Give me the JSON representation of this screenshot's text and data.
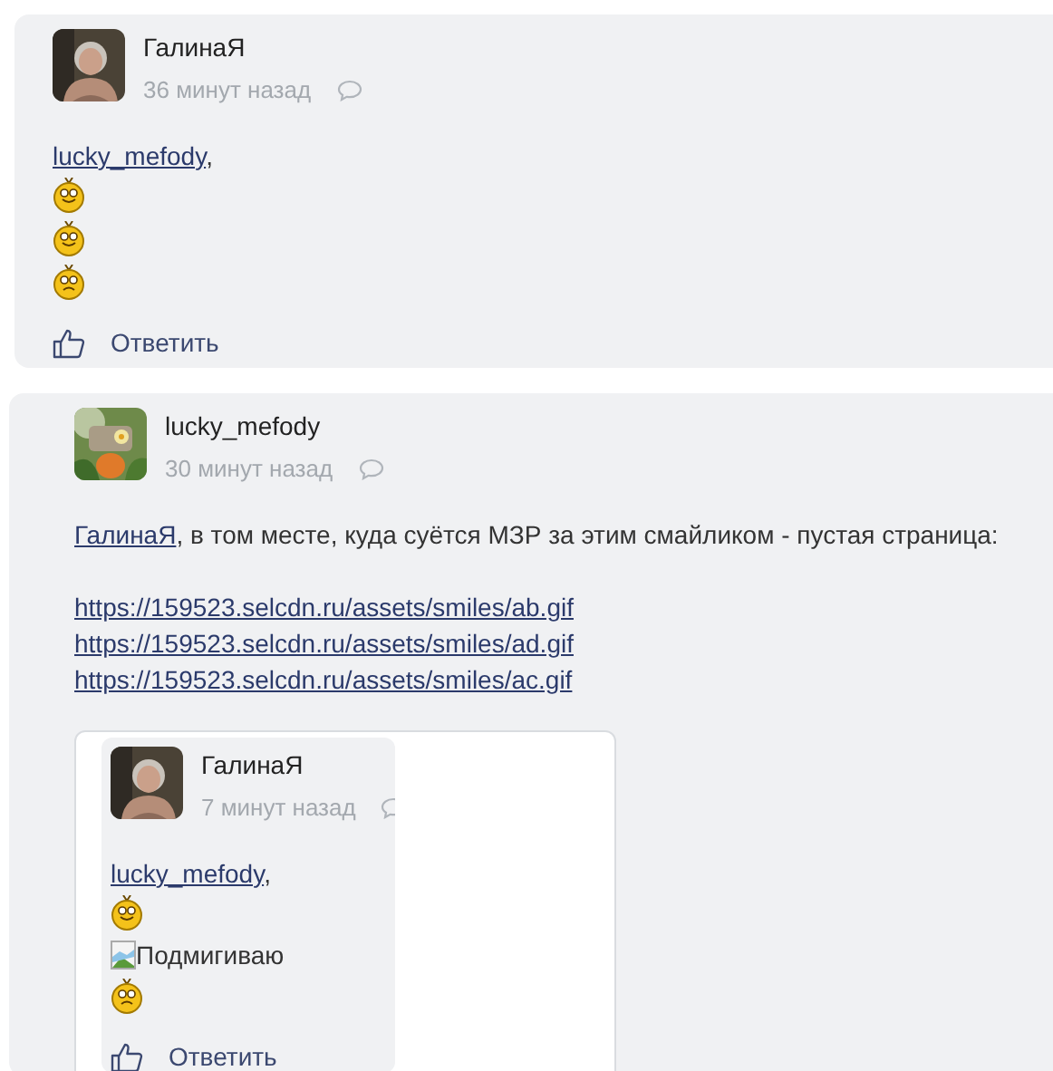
{
  "comments": [
    {
      "author": "ГалинаЯ",
      "time": "36 минут назад",
      "reply_label": "Ответить",
      "body": [
        {
          "kind": "line",
          "parts": [
            {
              "kind": "mention",
              "text": "lucky_mefody"
            },
            {
              "kind": "text",
              "text": ","
            }
          ]
        },
        {
          "kind": "smile"
        },
        {
          "kind": "smile"
        },
        {
          "kind": "frown"
        }
      ]
    },
    {
      "author": "lucky_mefody",
      "time": "30 минут назад",
      "body": [
        {
          "kind": "line",
          "parts": [
            {
              "kind": "mention",
              "text": "ГалинаЯ"
            },
            {
              "kind": "text",
              "text": ", в том месте, куда суётся МЗР за этим смайликом - пустая страница:"
            }
          ]
        },
        {
          "kind": "gap"
        },
        {
          "kind": "link",
          "text": "https://159523.selcdn.ru/assets/smiles/ab.gif"
        },
        {
          "kind": "link",
          "text": "https://159523.selcdn.ru/assets/smiles/ad.gif"
        },
        {
          "kind": "link",
          "text": "https://159523.selcdn.ru/assets/smiles/ac.gif"
        },
        {
          "kind": "quote",
          "comment": {
            "author": "ГалинаЯ",
            "time": "7 минут назад",
            "reply_label": "Ответить",
            "body": [
              {
                "kind": "line",
                "parts": [
                  {
                    "kind": "mention",
                    "text": "lucky_mefody"
                  },
                  {
                    "kind": "text",
                    "text": ","
                  }
                ]
              },
              {
                "kind": "smile"
              },
              {
                "kind": "broken_image",
                "alt": "Подмигиваю"
              },
              {
                "kind": "frown"
              }
            ]
          }
        }
      ]
    }
  ]
}
